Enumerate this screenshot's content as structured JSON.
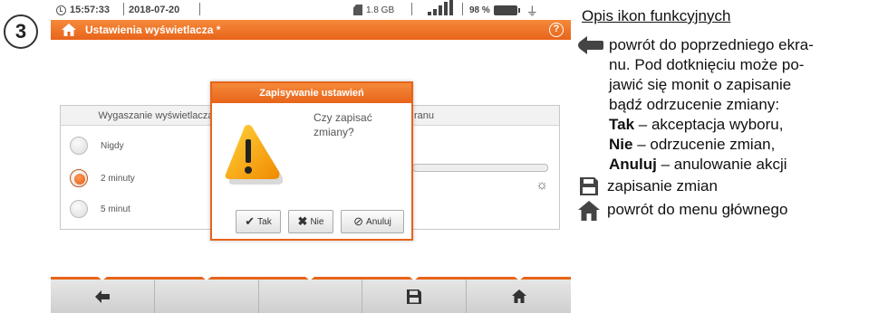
{
  "step": "3",
  "status": {
    "time": "15:57:33",
    "date": "2018-07-20",
    "storage": "1.8 GB",
    "battery": "98 %"
  },
  "titlebar": {
    "title": "Ustawienia wyświetlacza *",
    "help": "?"
  },
  "left_panel": {
    "header": "Wygaszanie wyświetlacza",
    "options": [
      {
        "label": "Nigdy",
        "selected": false
      },
      {
        "label": "2 minuty",
        "selected": true
      },
      {
        "label": "5 minut",
        "selected": false
      }
    ]
  },
  "right_panel": {
    "header_fragment": "ranu"
  },
  "dialog": {
    "title": "Zapisywanie ustawień",
    "message": "Czy zapisać zmiany?",
    "buttons": {
      "yes": "Tak",
      "no": "Nie",
      "cancel": "Anuluj"
    }
  },
  "bottom_bar": {
    "buttons": [
      "back-arrow-icon",
      "",
      "",
      "save-icon",
      "home-icon"
    ]
  },
  "legend": {
    "title": "Opis ikon funkcyjnych",
    "back": {
      "line1": "powrót do poprzedniego ekra-",
      "line2": "nu. Pod dotknięciu może po-",
      "line3": "jawić się monit o zapisanie",
      "line4": "bądź odrzucenie zmiany:",
      "yes_term": "Tak",
      "yes_desc": " – akceptacja wyboru,",
      "no_term": "Nie",
      "no_desc": " – odrzucenie zmian,",
      "cancel_term": "Anuluj",
      "cancel_desc": " – anulowanie akcji"
    },
    "save": "zapisanie zmian",
    "home": "powrót do menu głównego"
  },
  "colors": {
    "accent": "#e8641a",
    "selected_radio": "#f07020"
  }
}
